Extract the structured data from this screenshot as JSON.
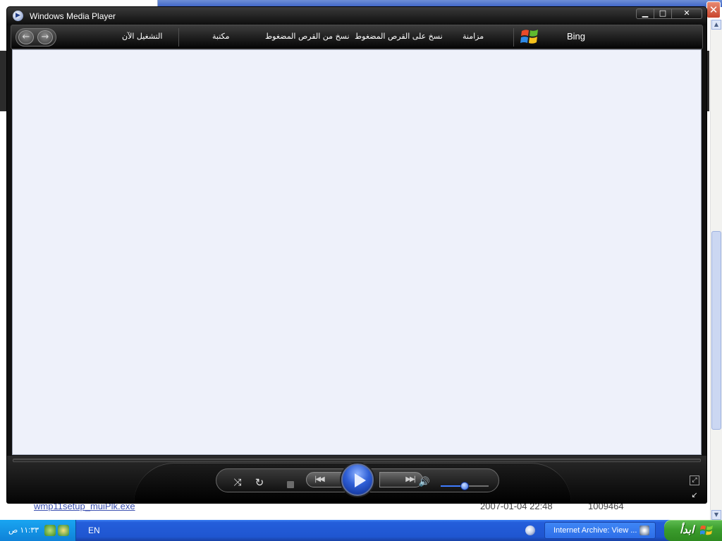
{
  "background_page": {
    "file_row": {
      "name": "wmp11setup_muiPlk.exe",
      "date": "2007-01-04 22:48",
      "size": "1009464"
    }
  },
  "wmp": {
    "title": "Windows Media Player",
    "window_buttons": {
      "minimize": "▁",
      "maximize": "□",
      "close": "✕"
    },
    "nav": {
      "back_icon": "←",
      "forward_icon": "→",
      "tabs": {
        "now_playing": "التشغيل الآن",
        "library": "مكتبة",
        "rip": "نسخ من القرص المضغوط",
        "burn": "نسخ على القرص المضغوط",
        "sync": "مزامنة",
        "bing": "Bing"
      }
    },
    "controls": {
      "shuffle_icon": "⤨",
      "repeat_icon": "↻",
      "prev_label": "|◀◀",
      "next_label": "▶▶|",
      "volume_icon": "🔊",
      "volume_level": 0.5,
      "switch_skin_icon": "⤢",
      "compact_icon": "↙"
    }
  },
  "taskbar": {
    "clock": "١١:٣٣ ص",
    "language": "EN",
    "task_button": "Internet Archive: View ...",
    "start_label": "ابدأ"
  },
  "colors": {
    "content_bg": "#eef1fa",
    "taskbar_blue": "#245edb",
    "start_green": "#3b9c2d",
    "play_blue": "#2f5fd6"
  }
}
